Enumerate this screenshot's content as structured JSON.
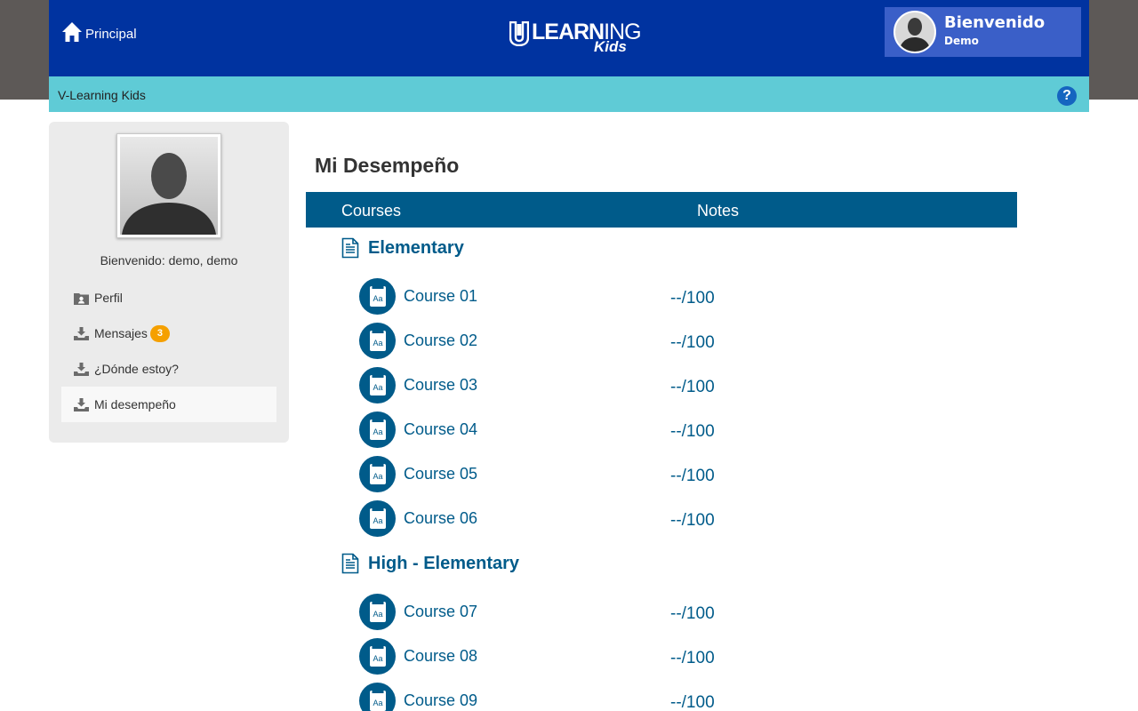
{
  "header": {
    "home_label": "Principal",
    "logo_text_bold": "LEARN",
    "logo_text_thin": "ING",
    "logo_sub": "Kids",
    "welcome_title": "Bienvenido",
    "welcome_user": "Demo"
  },
  "subheader": {
    "title": "V-Learning Kids",
    "help_label": "?"
  },
  "sidebar": {
    "greeting": "Bienvenido: demo, demo",
    "items": [
      {
        "label": "Perfil",
        "icon": "profile-folder-icon"
      },
      {
        "label": "Mensajes",
        "icon": "download-tray-icon",
        "badge": "3"
      },
      {
        "label": "¿Dónde estoy?",
        "icon": "download-tray-icon"
      },
      {
        "label": "Mi desempeño",
        "icon": "download-tray-icon",
        "active": true
      }
    ]
  },
  "main": {
    "title": "Mi Desempeño",
    "columns": {
      "courses": "Courses",
      "notes": "Notes"
    },
    "levels": [
      {
        "name": "Elementary",
        "courses": [
          {
            "name": "Course 01",
            "note": "--/100"
          },
          {
            "name": "Course 02",
            "note": "--/100"
          },
          {
            "name": "Course 03",
            "note": "--/100"
          },
          {
            "name": "Course 04",
            "note": "--/100"
          },
          {
            "name": "Course 05",
            "note": "--/100"
          },
          {
            "name": "Course 06",
            "note": "--/100"
          }
        ]
      },
      {
        "name": "High - Elementary",
        "courses": [
          {
            "name": "Course 07",
            "note": "--/100"
          },
          {
            "name": "Course 08",
            "note": "--/100"
          },
          {
            "name": "Course 09",
            "note": "--/100"
          }
        ]
      }
    ]
  },
  "colors": {
    "topbar": "#0033a0",
    "subbar": "#5fcbd6",
    "primary": "#005b8a",
    "badge": "#f5a000"
  }
}
